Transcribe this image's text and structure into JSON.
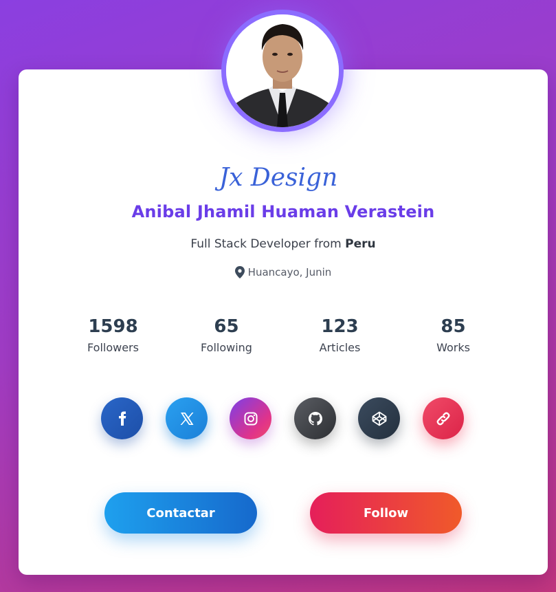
{
  "profile": {
    "brand": "Jx Design",
    "name": "Anibal Jhamil Huaman Verastein",
    "role_prefix": "Full Stack Developer from ",
    "role_country": "Peru",
    "location": "Huancayo, Junin"
  },
  "stats": [
    {
      "value": "1598",
      "label": "Followers"
    },
    {
      "value": "65",
      "label": "Following"
    },
    {
      "value": "123",
      "label": "Articles"
    },
    {
      "value": "85",
      "label": "Works"
    }
  ],
  "socials": [
    {
      "icon": "facebook-icon"
    },
    {
      "icon": "x-icon"
    },
    {
      "icon": "instagram-icon"
    },
    {
      "icon": "github-icon"
    },
    {
      "icon": "codepen-icon"
    },
    {
      "icon": "link-icon"
    }
  ],
  "buttons": {
    "contact_label": "Contactar",
    "follow_label": "Follow"
  },
  "colors": {
    "name": "#6a3de8",
    "avatar_ring": "#8b6cff",
    "contact": "#1ea0ee",
    "follow": "#e51f5a"
  }
}
